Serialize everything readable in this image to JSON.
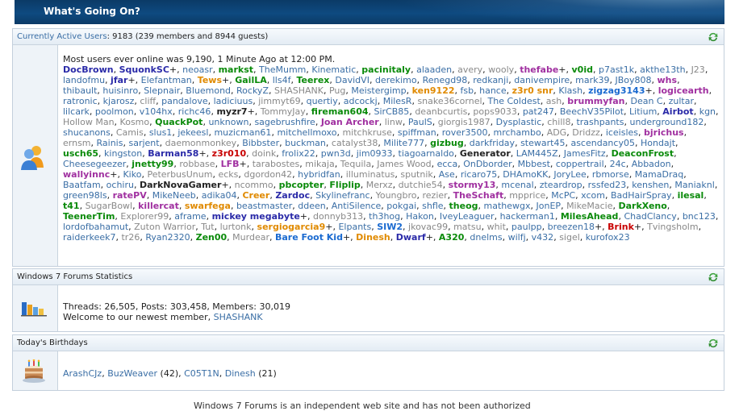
{
  "header": {
    "title": "What's Going On?"
  },
  "active": {
    "label": "Currently Active Users",
    "count_text": ": 9183 (239 members and 8944 guests)",
    "most_online": "Most users ever online was 9,190, 1 Minute Ago at 12:00 PM.",
    "users": [
      {
        "n": "DocBrown",
        "c": "#2a2aa8",
        "b": true
      },
      {
        "n": "SquonkSC",
        "c": "#2a2aa8",
        "b": true,
        "p": true
      },
      {
        "n": "neoasr",
        "c": "#3a6ea5"
      },
      {
        "n": "markst",
        "c": "#0a8a0a",
        "b": true
      },
      {
        "n": "TheMumm",
        "c": "#3a6ea5"
      },
      {
        "n": "Kinematic",
        "c": "#3a6ea5"
      },
      {
        "n": "pacinitaly",
        "c": "#0a8a0a",
        "b": true
      },
      {
        "n": "alaaden",
        "c": "#3a6ea5"
      },
      {
        "n": "avery",
        "c": "#888"
      },
      {
        "n": "wooly",
        "c": "#888"
      },
      {
        "n": "thefabe",
        "c": "#a030a0",
        "b": true,
        "p": true
      },
      {
        "n": "v0id",
        "c": "#0a8a0a",
        "b": true
      },
      {
        "n": "p7ast1k",
        "c": "#3a6ea5"
      },
      {
        "n": "akthe13th",
        "c": "#3a6ea5"
      },
      {
        "n": "J23",
        "c": "#888"
      },
      {
        "n": "landofmu",
        "c": "#3a6ea5"
      },
      {
        "n": "jfar",
        "c": "#2a2aa8",
        "b": true,
        "p": true
      },
      {
        "n": "Elefantman",
        "c": "#3a6ea5"
      },
      {
        "n": "Tews",
        "c": "#e08a00",
        "b": true,
        "p": true
      },
      {
        "n": "GailLA",
        "c": "#0a8a0a",
        "b": true
      },
      {
        "n": "lls4f",
        "c": "#3a6ea5"
      },
      {
        "n": "Teerex",
        "c": "#0a8a0a",
        "b": true
      },
      {
        "n": "DavidVI",
        "c": "#3a6ea5"
      },
      {
        "n": "derekimo",
        "c": "#3a6ea5"
      },
      {
        "n": "Renegd98",
        "c": "#3a6ea5"
      },
      {
        "n": "redkanji",
        "c": "#3a6ea5"
      },
      {
        "n": "danivempire",
        "c": "#3a6ea5"
      },
      {
        "n": "mark39",
        "c": "#3a6ea5"
      },
      {
        "n": "JBoy808",
        "c": "#3a6ea5"
      },
      {
        "n": "whs",
        "c": "#a030a0",
        "b": true
      },
      {
        "n": "thibault",
        "c": "#3a6ea5"
      },
      {
        "n": "huisinro",
        "c": "#3a6ea5"
      },
      {
        "n": "Slepnair",
        "c": "#3a6ea5"
      },
      {
        "n": "Bluemond",
        "c": "#3a6ea5"
      },
      {
        "n": "RockyZ",
        "c": "#3a6ea5"
      },
      {
        "n": "SHASHANK",
        "c": "#888"
      },
      {
        "n": "Pug",
        "c": "#888"
      },
      {
        "n": "Meistergimp",
        "c": "#3a6ea5"
      },
      {
        "n": "ken9122",
        "c": "#e08a00",
        "b": true
      },
      {
        "n": "fsb",
        "c": "#3a6ea5"
      },
      {
        "n": "hance",
        "c": "#3a6ea5"
      },
      {
        "n": "z3r0 snr",
        "c": "#e08a00",
        "b": true
      },
      {
        "n": "Klash",
        "c": "#3a6ea5"
      },
      {
        "n": "zigzag3143",
        "c": "#1a6ad0",
        "b": true,
        "p": true
      },
      {
        "n": "logicearth",
        "c": "#a030a0",
        "b": true
      },
      {
        "n": "ratronic",
        "c": "#3a6ea5"
      },
      {
        "n": "kjarosz",
        "c": "#3a6ea5"
      },
      {
        "n": "cliff",
        "c": "#888"
      },
      {
        "n": "pandalove",
        "c": "#3a6ea5"
      },
      {
        "n": "ladiciuus",
        "c": "#3a6ea5"
      },
      {
        "n": "jimmyt69",
        "c": "#888"
      },
      {
        "n": "quertiy",
        "c": "#3a6ea5"
      },
      {
        "n": "adcockj",
        "c": "#3a6ea5"
      },
      {
        "n": "MilesR",
        "c": "#3a6ea5"
      },
      {
        "n": "snake36cornel",
        "c": "#888"
      },
      {
        "n": "The Coldest",
        "c": "#3a6ea5"
      },
      {
        "n": "ash",
        "c": "#888"
      },
      {
        "n": "brummyfan",
        "c": "#a030a0",
        "b": true
      },
      {
        "n": "Dean C",
        "c": "#3a6ea5"
      },
      {
        "n": "zultar",
        "c": "#3a6ea5"
      },
      {
        "n": "lilcark",
        "c": "#3a6ea5"
      },
      {
        "n": "poolmon",
        "c": "#3a6ea5"
      },
      {
        "n": "v104hx",
        "c": "#3a6ea5"
      },
      {
        "n": "richc46",
        "c": "#3a6ea5"
      },
      {
        "n": "myzr7",
        "c": "#222",
        "b": true,
        "p": true
      },
      {
        "n": "TommyJay",
        "c": "#888"
      },
      {
        "n": "fireman604",
        "c": "#0a8a0a",
        "b": true
      },
      {
        "n": "SirCB85",
        "c": "#3a6ea5"
      },
      {
        "n": "deanbcurtis",
        "c": "#888"
      },
      {
        "n": "pops9033",
        "c": "#888"
      },
      {
        "n": "pat247",
        "c": "#3a6ea5"
      },
      {
        "n": "BeechV35Pilot",
        "c": "#3a6ea5"
      },
      {
        "n": "Litium",
        "c": "#3a6ea5"
      },
      {
        "n": "Airbot",
        "c": "#2a2aa8",
        "b": true
      },
      {
        "n": "kgn",
        "c": "#3a6ea5"
      },
      {
        "n": "Hollow Man",
        "c": "#888"
      },
      {
        "n": "Kosmo",
        "c": "#888"
      },
      {
        "n": "QuackPot",
        "c": "#0a8a0a",
        "b": true
      },
      {
        "n": "unknown",
        "c": "#3a6ea5"
      },
      {
        "n": "sagebrushfire",
        "c": "#3a6ea5"
      },
      {
        "n": "Joan Archer",
        "c": "#a030a0",
        "b": true
      },
      {
        "n": "linw",
        "c": "#888"
      },
      {
        "n": "PaulS",
        "c": "#3a6ea5"
      },
      {
        "n": "giorgis1987",
        "c": "#888"
      },
      {
        "n": "Dysplastic",
        "c": "#3a6ea5"
      },
      {
        "n": "chill8",
        "c": "#888"
      },
      {
        "n": "trashpants",
        "c": "#3a6ea5"
      },
      {
        "n": "underground182",
        "c": "#3a6ea5"
      },
      {
        "n": "shucanons",
        "c": "#3a6ea5"
      },
      {
        "n": "Camis",
        "c": "#888"
      },
      {
        "n": "slus1",
        "c": "#3a6ea5"
      },
      {
        "n": "jekeesl",
        "c": "#3a6ea5"
      },
      {
        "n": "muzicman61",
        "c": "#3a6ea5"
      },
      {
        "n": "mitchellmoxo",
        "c": "#3a6ea5"
      },
      {
        "n": "mitchkruse",
        "c": "#888"
      },
      {
        "n": "spiffman",
        "c": "#3a6ea5"
      },
      {
        "n": "rover3500",
        "c": "#3a6ea5"
      },
      {
        "n": "mrchambo",
        "c": "#3a6ea5"
      },
      {
        "n": "ADG",
        "c": "#888"
      },
      {
        "n": "Dridzz",
        "c": "#888"
      },
      {
        "n": "iceisles",
        "c": "#3a6ea5"
      },
      {
        "n": "bjrichus",
        "c": "#a030a0",
        "b": true
      },
      {
        "n": "ernsm",
        "c": "#888"
      },
      {
        "n": "Rainis",
        "c": "#3a6ea5"
      },
      {
        "n": "sarjent",
        "c": "#3a6ea5"
      },
      {
        "n": "daemonmonkey",
        "c": "#888"
      },
      {
        "n": "Bibbster",
        "c": "#3a6ea5"
      },
      {
        "n": "buckman",
        "c": "#3a6ea5"
      },
      {
        "n": "catalyst38",
        "c": "#888"
      },
      {
        "n": "Milite777",
        "c": "#3a6ea5"
      },
      {
        "n": "gizbug",
        "c": "#0a8a0a",
        "b": true
      },
      {
        "n": "darkfriday",
        "c": "#3a6ea5"
      },
      {
        "n": "stewart45",
        "c": "#3a6ea5"
      },
      {
        "n": "ascendancy05",
        "c": "#3a6ea5"
      },
      {
        "n": "Hondajt",
        "c": "#3a6ea5"
      },
      {
        "n": "usch65",
        "c": "#0a8a0a",
        "b": true
      },
      {
        "n": "kingston",
        "c": "#3a6ea5"
      },
      {
        "n": "Barman58",
        "c": "#2a2aa8",
        "b": true,
        "p": true
      },
      {
        "n": "z3r010",
        "c": "#c80000",
        "b": true
      },
      {
        "n": "doink",
        "c": "#888"
      },
      {
        "n": "frolix22",
        "c": "#3a6ea5"
      },
      {
        "n": "pwn3d",
        "c": "#3a6ea5"
      },
      {
        "n": "jim0933",
        "c": "#3a6ea5"
      },
      {
        "n": "tiagoarnaldo",
        "c": "#3a6ea5"
      },
      {
        "n": "Generator",
        "c": "#222",
        "b": true
      },
      {
        "n": "LAM445Z",
        "c": "#3a6ea5"
      },
      {
        "n": "JamesFitz",
        "c": "#3a6ea5"
      },
      {
        "n": "DeaconFrost",
        "c": "#0a8a0a",
        "b": true
      },
      {
        "n": "Cheesegeezer",
        "c": "#3a6ea5"
      },
      {
        "n": "jnetty99",
        "c": "#0a8a0a",
        "b": true
      },
      {
        "n": "robbase",
        "c": "#888"
      },
      {
        "n": "LFB",
        "c": "#a030a0",
        "b": true,
        "p": true
      },
      {
        "n": "tarabostes",
        "c": "#888"
      },
      {
        "n": "mikaja",
        "c": "#888"
      },
      {
        "n": "Tequila",
        "c": "#888"
      },
      {
        "n": "James Wood",
        "c": "#888"
      },
      {
        "n": "ecca",
        "c": "#3a6ea5"
      },
      {
        "n": "OnDborder",
        "c": "#3a6ea5"
      },
      {
        "n": "Mbbest",
        "c": "#3a6ea5"
      },
      {
        "n": "coppertrail",
        "c": "#3a6ea5"
      },
      {
        "n": "24c",
        "c": "#3a6ea5"
      },
      {
        "n": "Abbadon",
        "c": "#3a6ea5"
      },
      {
        "n": "wallyinnc",
        "c": "#a030a0",
        "b": true,
        "p": true
      },
      {
        "n": "Kiko",
        "c": "#3a6ea5"
      },
      {
        "n": "PeterbusUnum",
        "c": "#888"
      },
      {
        "n": "ecks",
        "c": "#888"
      },
      {
        "n": "dgordon42",
        "c": "#888"
      },
      {
        "n": "hybridfan",
        "c": "#3a6ea5"
      },
      {
        "n": "illuminatus",
        "c": "#888"
      },
      {
        "n": "sputnik",
        "c": "#888"
      },
      {
        "n": "Ase",
        "c": "#3a6ea5"
      },
      {
        "n": "ricaro75",
        "c": "#3a6ea5"
      },
      {
        "n": "DHAmoKK",
        "c": "#3a6ea5"
      },
      {
        "n": "JoryLee",
        "c": "#3a6ea5"
      },
      {
        "n": "rbmorse",
        "c": "#3a6ea5"
      },
      {
        "n": "MamaDraq",
        "c": "#3a6ea5"
      },
      {
        "n": "Baatfam",
        "c": "#3a6ea5"
      },
      {
        "n": "ochiru",
        "c": "#3a6ea5"
      },
      {
        "n": "DarkNovaGamer",
        "c": "#222",
        "b": true,
        "p": true
      },
      {
        "n": "ncommo",
        "c": "#888"
      },
      {
        "n": "pbcopter",
        "c": "#0a8a0a",
        "b": true
      },
      {
        "n": "Fliplip",
        "c": "#0a8a0a",
        "b": true
      },
      {
        "n": "Merxz",
        "c": "#888"
      },
      {
        "n": "dutchie54",
        "c": "#888"
      },
      {
        "n": "stormy13",
        "c": "#a030a0",
        "b": true
      },
      {
        "n": "mcenal",
        "c": "#3a6ea5"
      },
      {
        "n": "zteardrop",
        "c": "#3a6ea5"
      },
      {
        "n": "rssfed23",
        "c": "#3a6ea5"
      },
      {
        "n": "kenshen",
        "c": "#3a6ea5"
      },
      {
        "n": "Maniaknl",
        "c": "#3a6ea5"
      },
      {
        "n": "green98ls",
        "c": "#3a6ea5"
      },
      {
        "n": "ratePV",
        "c": "#a030a0",
        "b": true
      },
      {
        "n": "MikeNeeb",
        "c": "#3a6ea5"
      },
      {
        "n": "adika04",
        "c": "#3a6ea5"
      },
      {
        "n": "Creer",
        "c": "#e08a00",
        "b": true
      },
      {
        "n": "Zardoc",
        "c": "#2a2aa8",
        "b": true
      },
      {
        "n": "Skylinefranc",
        "c": "#3a6ea5"
      },
      {
        "n": "Youngbro",
        "c": "#888"
      },
      {
        "n": "rezier",
        "c": "#888"
      },
      {
        "n": "TheSchaft",
        "c": "#a030a0",
        "b": true
      },
      {
        "n": "mpprice",
        "c": "#888"
      },
      {
        "n": "McPC",
        "c": "#3a6ea5"
      },
      {
        "n": "xcom",
        "c": "#3a6ea5"
      },
      {
        "n": "BadHairSpray",
        "c": "#3a6ea5"
      },
      {
        "n": "ilesal",
        "c": "#0a8a0a",
        "b": true
      },
      {
        "n": "t41",
        "c": "#0a8a0a",
        "b": true
      },
      {
        "n": "SugarBowl",
        "c": "#888"
      },
      {
        "n": "killercat",
        "c": "#a030a0",
        "b": true
      },
      {
        "n": "swarfega",
        "c": "#e08a00",
        "b": true
      },
      {
        "n": "beastmaster",
        "c": "#3a6ea5"
      },
      {
        "n": "ddeen",
        "c": "#3a6ea5"
      },
      {
        "n": "AntiSilence",
        "c": "#3a6ea5"
      },
      {
        "n": "pokgai",
        "c": "#3a6ea5"
      },
      {
        "n": "shfle",
        "c": "#3a6ea5"
      },
      {
        "n": "theog",
        "c": "#0a8a0a",
        "b": true
      },
      {
        "n": "mathewgx",
        "c": "#3a6ea5"
      },
      {
        "n": "JonEP",
        "c": "#3a6ea5"
      },
      {
        "n": "MikeMacie",
        "c": "#888"
      },
      {
        "n": "DarkXeno",
        "c": "#0a8a0a",
        "b": true
      },
      {
        "n": "TeenerTim",
        "c": "#0a8a0a",
        "b": true
      },
      {
        "n": "Explorer99",
        "c": "#888"
      },
      {
        "n": "aframe",
        "c": "#3a6ea5"
      },
      {
        "n": "mickey megabyte",
        "c": "#2a2aa8",
        "b": true,
        "p": true
      },
      {
        "n": "donnyb313",
        "c": "#888"
      },
      {
        "n": "th3hog",
        "c": "#3a6ea5"
      },
      {
        "n": "Hakon",
        "c": "#3a6ea5"
      },
      {
        "n": "IveyLeaguer",
        "c": "#3a6ea5"
      },
      {
        "n": "hackerman1",
        "c": "#3a6ea5"
      },
      {
        "n": "MilesAhead",
        "c": "#0a8a0a",
        "b": true
      },
      {
        "n": "ChadClancy",
        "c": "#3a6ea5"
      },
      {
        "n": "bnc123",
        "c": "#3a6ea5"
      },
      {
        "n": "lordofbahamut",
        "c": "#3a6ea5"
      },
      {
        "n": "Zuton Warrior",
        "c": "#888"
      },
      {
        "n": "Tut",
        "c": "#888"
      },
      {
        "n": "lurtonk",
        "c": "#888"
      },
      {
        "n": "sergiogarcia9",
        "c": "#e08a00",
        "b": true,
        "p": true
      },
      {
        "n": "Elpants",
        "c": "#3a6ea5"
      },
      {
        "n": "SIW2",
        "c": "#1a6ad0",
        "b": true
      },
      {
        "n": "jkovac99",
        "c": "#888"
      },
      {
        "n": "matsu",
        "c": "#888"
      },
      {
        "n": "whit",
        "c": "#888"
      },
      {
        "n": "paulpp",
        "c": "#3a6ea5"
      },
      {
        "n": "breezen18",
        "c": "#3a6ea5",
        "p": true
      },
      {
        "n": "Brink",
        "c": "#c80000",
        "b": true,
        "p": true
      },
      {
        "n": "Tvingsholm",
        "c": "#888"
      },
      {
        "n": "raiderkeek7",
        "c": "#3a6ea5"
      },
      {
        "n": "tr26",
        "c": "#888"
      },
      {
        "n": "Ryan2320",
        "c": "#3a6ea5"
      },
      {
        "n": "Zen00",
        "c": "#0a8a0a",
        "b": true
      },
      {
        "n": "Murdear",
        "c": "#888"
      },
      {
        "n": "Bare Foot Kid",
        "c": "#1a6ad0",
        "b": true,
        "p": true
      },
      {
        "n": "Dinesh",
        "c": "#e08a00",
        "b": true
      },
      {
        "n": "Dwarf",
        "c": "#2a2aa8",
        "b": true,
        "p": true
      },
      {
        "n": "A320",
        "c": "#0a8a0a",
        "b": true
      },
      {
        "n": "dnelms",
        "c": "#3a6ea5"
      },
      {
        "n": "wilfj",
        "c": "#3a6ea5"
      },
      {
        "n": "v432",
        "c": "#3a6ea5"
      },
      {
        "n": "sigel",
        "c": "#888"
      },
      {
        "n": "kurofox23",
        "c": "#3a6ea5"
      }
    ]
  },
  "stats": {
    "label": "Windows 7 Forums Statistics",
    "line1": "Threads: 26,505, Posts: 303,458, Members: 30,019",
    "welcome": "Welcome to our newest member,",
    "newest": "SHASHANK"
  },
  "birthdays": {
    "label": "Today's Birthdays",
    "items": [
      {
        "name": "ArashCJz",
        "age": ""
      },
      {
        "name": "BuzWeaver",
        "age": "(42)"
      },
      {
        "name": "C05T1N",
        "age": ""
      },
      {
        "name": "Dinesh",
        "age": "(21)"
      }
    ]
  },
  "footer": {
    "text": "Windows 7 Forums is an independent web site and has not been authorized"
  }
}
